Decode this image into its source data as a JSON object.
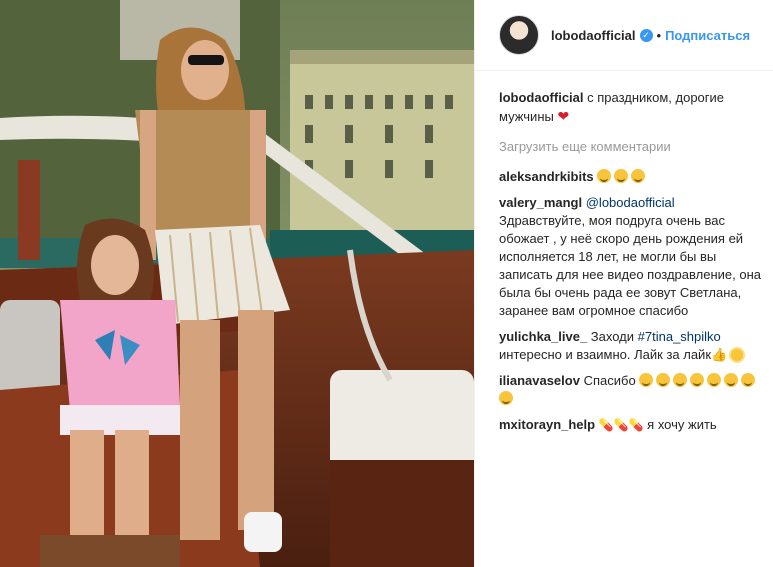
{
  "header": {
    "username": "lobodaofficial",
    "verified_icon": "verified-badge-icon",
    "dot": "•",
    "follow_label": "Подписаться"
  },
  "caption": {
    "username": "lobodaofficial",
    "text": "с праздником, дорогие мужчины"
  },
  "load_more": "Загрузить еще комментарии",
  "comments": [
    {
      "username": "aleksandrkibits",
      "text": ""
    },
    {
      "username": "valery_mangl",
      "mention": "@lobodaofficial",
      "text": "Здравствуйте, моя подруга очень вас обожает , у неё скоро день рождения ей исполняется 18 лет, не могли бы вы записать для нее видео поздравление, она была бы очень рада ее зовут Светлана, заранее вам огромное спасибо"
    },
    {
      "username": "yulichka_live_",
      "prefix": "Заходи",
      "mention": "#7tina_shpilko",
      "text": "интересно и взаимно. Лайк за лайк"
    },
    {
      "username": "ilianavaselov",
      "text": "Спасибо"
    },
    {
      "username": "mxitorayn_help",
      "text": "я хочу жить"
    }
  ],
  "colors": {
    "link": "#3897f0",
    "mention": "#003569",
    "muted": "#999999"
  }
}
